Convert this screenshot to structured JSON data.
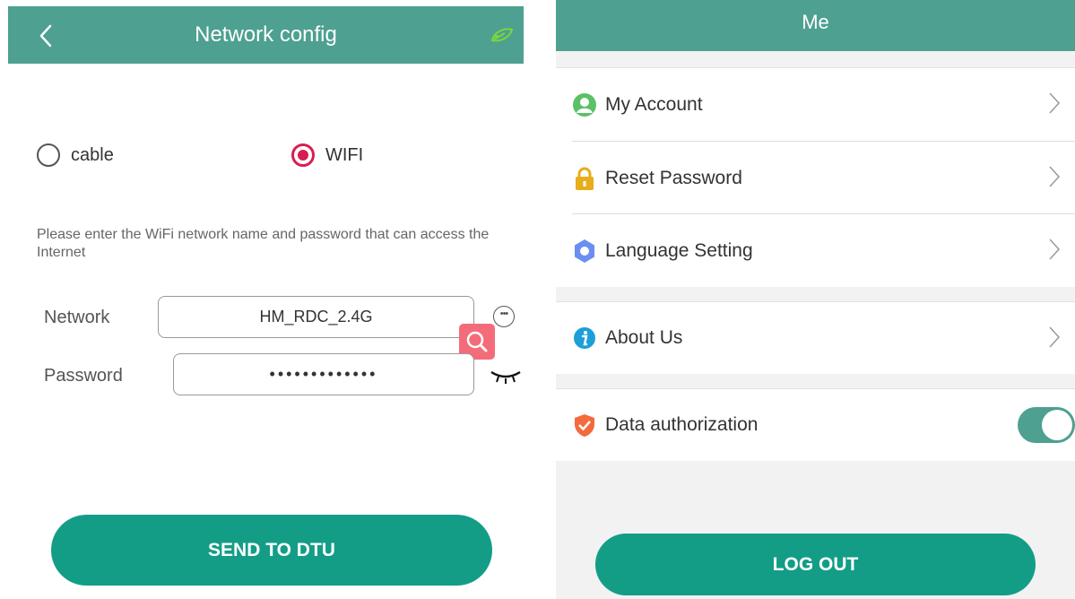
{
  "network_config": {
    "title": "Network config",
    "connection_options": [
      "cable",
      "WIFI"
    ],
    "selected_option": "WIFI",
    "hint": "Please enter the WiFi network name and password that can access the Internet",
    "network_label": "Network",
    "network_value": "HM_RDC_2.4G",
    "password_label": "Password",
    "password_mask": "•••••••••••••",
    "send_button": "SEND TO DTU"
  },
  "me": {
    "title": "Me",
    "menu": [
      {
        "label": "My Account",
        "icon": "user-icon"
      },
      {
        "label": "Reset Password",
        "icon": "lock-icon"
      },
      {
        "label": "Language Setting",
        "icon": "gear-icon"
      }
    ],
    "about_label": "About Us",
    "about_icon": "info-icon",
    "data_auth_label": "Data authorization",
    "data_auth_icon": "shield-icon",
    "data_auth_enabled": true,
    "logout_button": "LOG OUT"
  },
  "colors": {
    "header": "#4ea091",
    "button": "#139d87",
    "radio_active": "#d81d52",
    "search_button": "#f46b7a"
  }
}
